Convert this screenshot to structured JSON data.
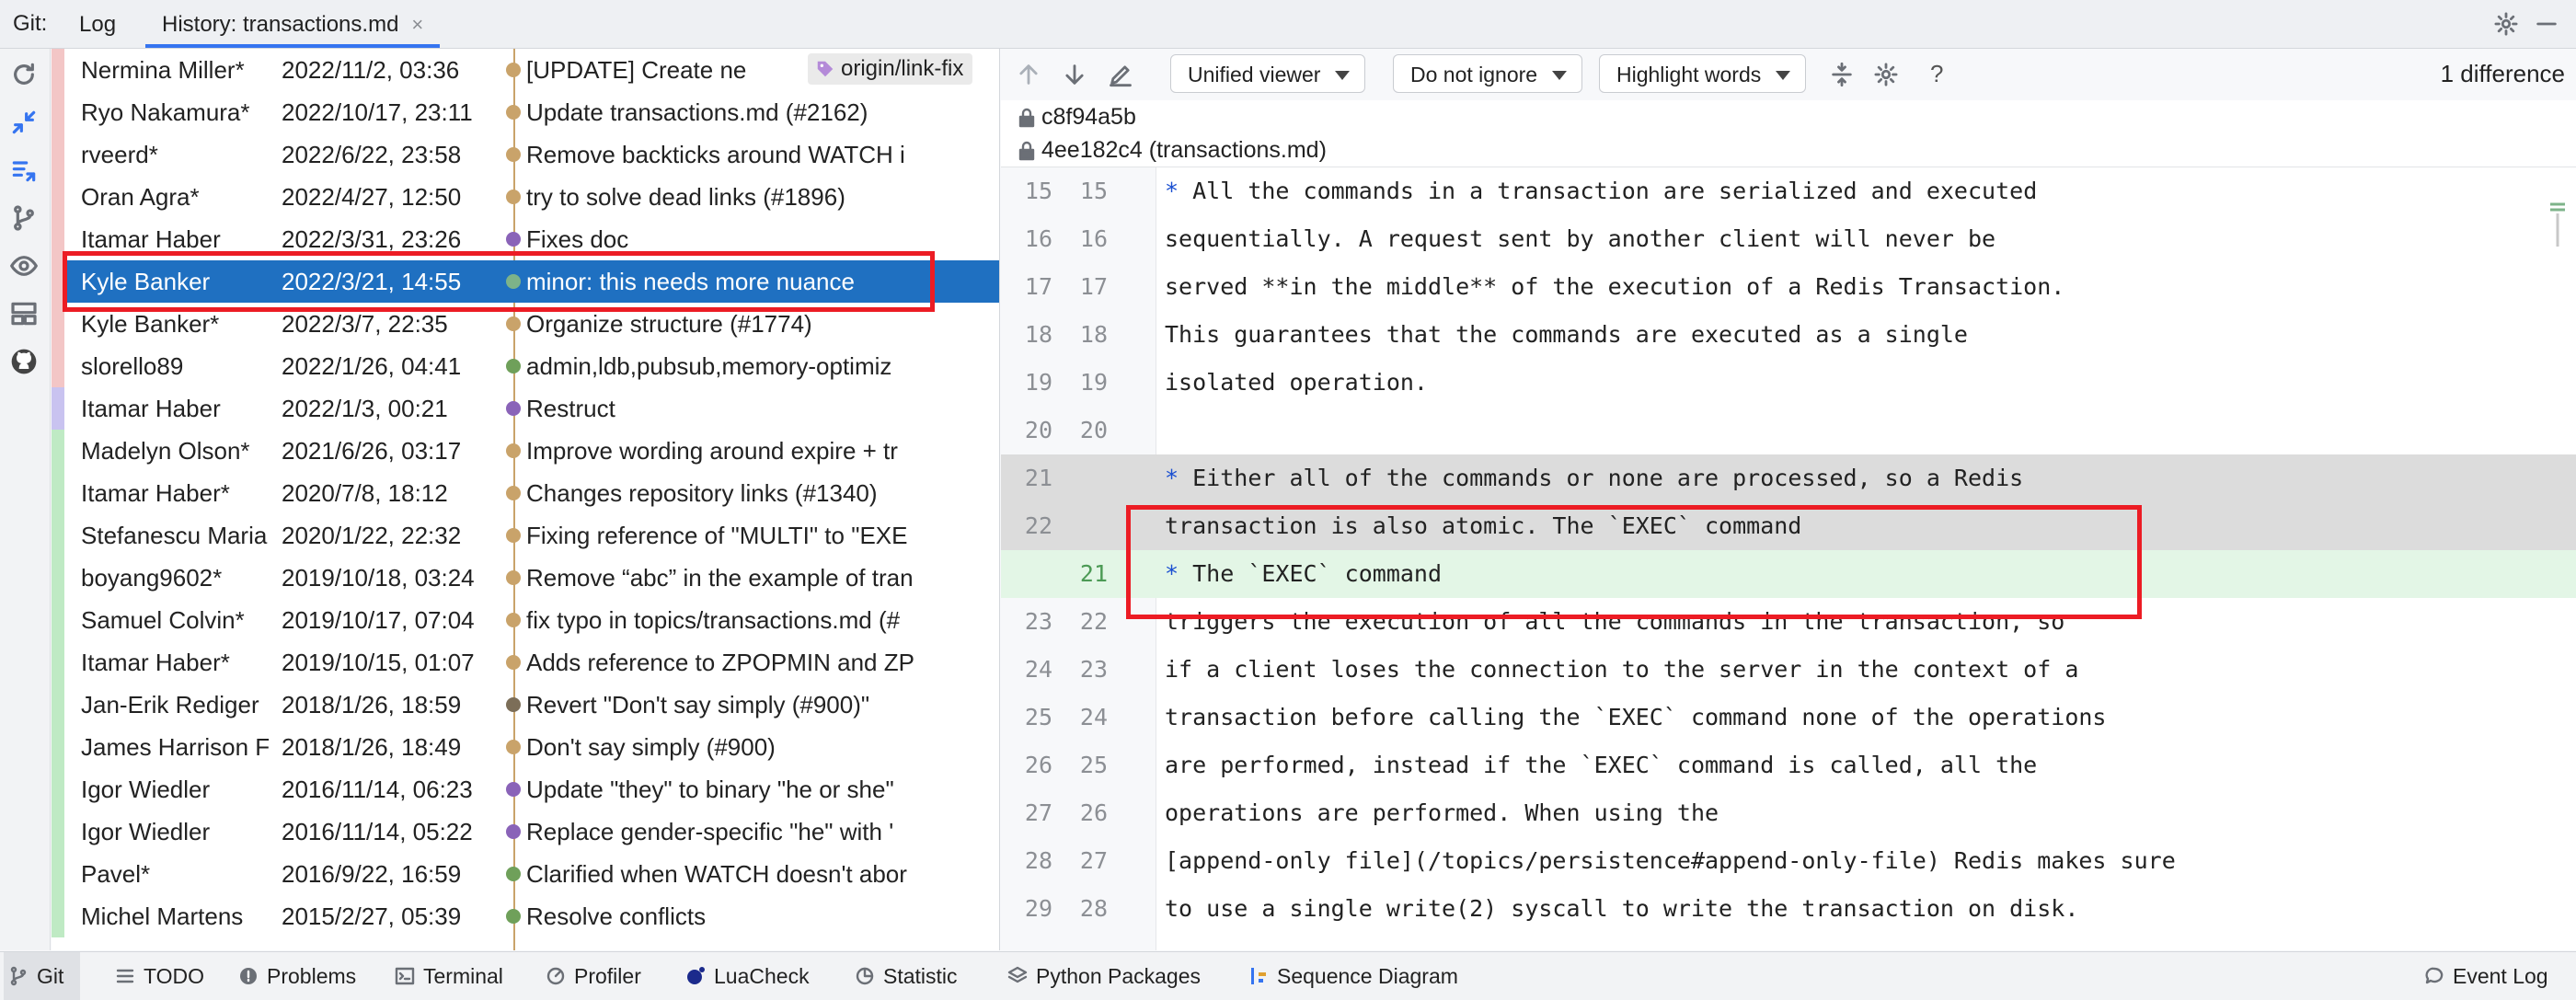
{
  "topbar": {
    "git_label": "Git:",
    "tabs": [
      {
        "label": "Log"
      },
      {
        "label": "History: transactions.md"
      }
    ],
    "close": "×"
  },
  "commits": [
    {
      "author": "Nermina Miller*",
      "date": "2022/11/2, 03:36",
      "message": "[UPDATE] Create ne",
      "bar": "#f3c6c6",
      "dot": "#c9a36a",
      "tag": "origin/link-fix"
    },
    {
      "author": "Ryo Nakamura*",
      "date": "2022/10/17, 23:11",
      "message": "Update transactions.md (#2162)",
      "bar": "#f3c6c6",
      "dot": "#c9a36a"
    },
    {
      "author": "rveerd*",
      "date": "2022/6/22, 23:58",
      "message": "Remove backticks around WATCH i",
      "bar": "#f3c6c6",
      "dot": "#c9a36a"
    },
    {
      "author": "Oran Agra*",
      "date": "2022/4/27, 12:50",
      "message": "try to solve dead links (#1896)",
      "bar": "#f3c6c6",
      "dot": "#c9a36a"
    },
    {
      "author": "Itamar Haber",
      "date": "2022/3/31, 23:26",
      "message": "Fixes doc",
      "bar": "#f3c6c6",
      "dot": "#8a63b8"
    },
    {
      "author": "Kyle Banker",
      "date": "2022/3/21, 14:55",
      "message": "minor: this needs more nuance",
      "bar": "#f3c6c6",
      "dot": "#7db389",
      "selected": true
    },
    {
      "author": "Kyle Banker*",
      "date": "2022/3/7, 22:35",
      "message": "Organize structure (#1774)",
      "bar": "#f3c6c6",
      "dot": "#c9a36a"
    },
    {
      "author": "slorello89",
      "date": "2022/1/26, 04:41",
      "message": "admin,ldb,pubsub,memory-optimiz",
      "bar": "#f3c6c6",
      "dot": "#6fa05a"
    },
    {
      "author": "Itamar Haber",
      "date": "2022/1/3, 00:21",
      "message": "Restruct",
      "bar": "#c9c3f0",
      "dot": "#8a63b8"
    },
    {
      "author": "Madelyn Olson*",
      "date": "2021/6/26, 03:17",
      "message": "Improve wording around expire + tr",
      "bar": "#bfeac4",
      "dot": "#c9a36a"
    },
    {
      "author": "Itamar Haber*",
      "date": "2020/7/8, 18:12",
      "message": "Changes repository links (#1340)",
      "bar": "#bfeac4",
      "dot": "#c9a36a"
    },
    {
      "author": "Stefanescu Maria",
      "date": "2020/1/22, 22:32",
      "message": "Fixing reference of \"MULTI\" to \"EXE",
      "bar": "#bfeac4",
      "dot": "#c9a36a"
    },
    {
      "author": "boyang9602*",
      "date": "2019/10/18, 03:24",
      "message": "Remove “abc” in the example of tran",
      "bar": "#bfeac4",
      "dot": "#c9a36a"
    },
    {
      "author": "Samuel Colvin*",
      "date": "2019/10/17, 07:04",
      "message": "fix typo in topics/transactions.md (#",
      "bar": "#bfeac4",
      "dot": "#c9a36a"
    },
    {
      "author": "Itamar Haber*",
      "date": "2019/10/15, 01:07",
      "message": "Adds reference to ZPOPMIN and ZP",
      "bar": "#bfeac4",
      "dot": "#c9a36a"
    },
    {
      "author": "Jan-Erik Rediger",
      "date": "2018/1/26, 18:59",
      "message": "Revert \"Don't say simply (#900)\"",
      "bar": "#bfeac4",
      "dot": "#7c6e58"
    },
    {
      "author": "James Harrison F",
      "date": "2018/1/26, 18:49",
      "message": "Don't say simply (#900)",
      "bar": "#bfeac4",
      "dot": "#c9a36a"
    },
    {
      "author": "Igor Wiedler",
      "date": "2016/11/14, 06:23",
      "message": "Update \"they\" to binary \"he or she\"",
      "bar": "#bfeac4",
      "dot": "#8a63b8"
    },
    {
      "author": "Igor Wiedler",
      "date": "2016/11/14, 05:22",
      "message": "Replace gender-specific \"he\" with '",
      "bar": "#bfeac4",
      "dot": "#8a63b8"
    },
    {
      "author": "Pavel*",
      "date": "2016/9/22, 16:59",
      "message": "Clarified when WATCH doesn't abor",
      "bar": "#bfeac4",
      "dot": "#6fa05a"
    },
    {
      "author": "Michel Martens",
      "date": "2015/2/27, 05:39",
      "message": "Resolve conflicts",
      "bar": "#bfeac4",
      "dot": "#6fa05a"
    }
  ],
  "diff": {
    "viewer": "Unified viewer",
    "ignore": "Do not ignore",
    "highlight": "Highlight words",
    "help": "?",
    "count": "1 difference",
    "hash1": "c8f94a5b",
    "hash2": "4ee182c4 (transactions.md)",
    "lines": [
      {
        "n1": "15",
        "n2": "15",
        "text": "* All the commands in a transaction are serialized and executed",
        "star": true
      },
      {
        "n1": "16",
        "n2": "16",
        "text": "sequentially. A request sent by another client will never be"
      },
      {
        "n1": "17",
        "n2": "17",
        "text": "served **in the middle** of the execution of a Redis Transaction."
      },
      {
        "n1": "18",
        "n2": "18",
        "text": "This guarantees that the commands are executed as a single"
      },
      {
        "n1": "19",
        "n2": "19",
        "text": "isolated operation."
      },
      {
        "n1": "20",
        "n2": "20",
        "text": ""
      },
      {
        "n1": "21",
        "n2": "",
        "text": "* Either all of the commands or none are processed, so a Redis",
        "star": true,
        "kind": "removed"
      },
      {
        "n1": "22",
        "n2": "",
        "text": "transaction is also atomic. The `EXEC` command",
        "kind": "removed"
      },
      {
        "n1": "",
        "n2": "21",
        "text": "* The `EXEC` command",
        "star": true,
        "kind": "added"
      },
      {
        "n1": "23",
        "n2": "22",
        "text": "triggers the execution of all the commands in the transaction, so"
      },
      {
        "n1": "24",
        "n2": "23",
        "text": "if a client loses the connection to the server in the context of a"
      },
      {
        "n1": "25",
        "n2": "24",
        "text": "transaction before calling the `EXEC` command none of the operations"
      },
      {
        "n1": "26",
        "n2": "25",
        "text": "are performed, instead if the `EXEC` command is called, all the"
      },
      {
        "n1": "27",
        "n2": "26",
        "text": "operations are performed. When using the"
      },
      {
        "n1": "28",
        "n2": "27",
        "text": "[append-only file](/topics/persistence#append-only-file) Redis makes sure"
      },
      {
        "n1": "29",
        "n2": "28",
        "text": "to use a single write(2) syscall to write the transaction on disk."
      }
    ]
  },
  "bottom": {
    "git": "Git",
    "todo": "TODO",
    "problems": "Problems",
    "terminal": "Terminal",
    "profiler": "Profiler",
    "luacheck": "LuaCheck",
    "statistic": "Statistic",
    "python_packages": "Python Packages",
    "sequence_diagram": "Sequence Diagram",
    "event_log": "Event Log"
  }
}
